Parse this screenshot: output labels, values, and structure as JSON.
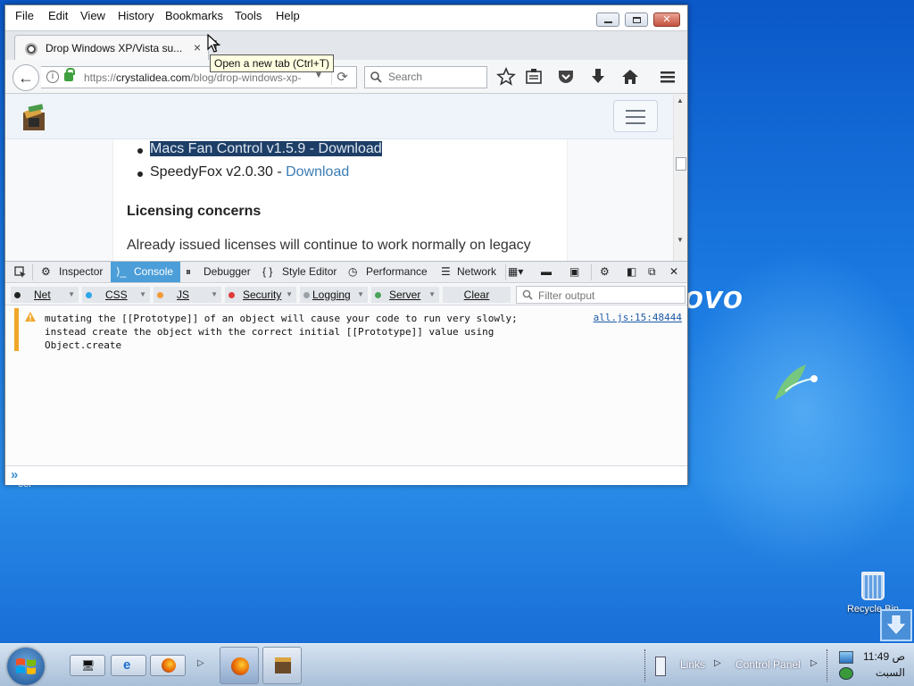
{
  "desktop": {
    "wallpaper_text": "ovo",
    "recycle_bin_label": "Recycle Bin",
    "shortcut_label_partial": "ool"
  },
  "window": {
    "menu": [
      "File",
      "Edit",
      "View",
      "History",
      "Bookmarks",
      "Tools",
      "Help"
    ],
    "tab_title": "Drop Windows XP/Vista su...",
    "tab_close": "×",
    "new_tab_glyph": "+",
    "tooltip": "Open a new tab (Ctrl+T)",
    "url_prefix": "https://",
    "url_host": "crystalidea.com",
    "url_path": "/blog/drop-windows-xp-",
    "search_placeholder": "Search"
  },
  "page": {
    "items": [
      {
        "text": "Macs Fan Control v1.5.9 - Download",
        "selected": true
      },
      {
        "text": "SpeedyFox v2.0.30 - ",
        "link": "Download"
      }
    ],
    "heading": "Licensing concerns",
    "paragraph": "Already issued licenses will continue to work normally on legacy"
  },
  "devtools": {
    "tabs": [
      "Inspector",
      "Console",
      "Debugger",
      "Style Editor",
      "Performance",
      "Network"
    ],
    "active_tab": "Console",
    "filters": [
      {
        "label": "Net",
        "dot": "#222222"
      },
      {
        "label": "CSS",
        "dot": "#2ba6e8"
      },
      {
        "label": "JS",
        "dot": "#f29a38"
      },
      {
        "label": "Security",
        "dot": "#e03a3a"
      },
      {
        "label": "Logging",
        "dot": "#9aa1a8"
      },
      {
        "label": "Server",
        "dot": "#4aa35a"
      }
    ],
    "clear_label": "Clear",
    "filter_placeholder": "Filter output",
    "message": "mutating the [[Prototype]] of an object will cause your code to run very slowly;\ninstead create the object with the correct initial [[Prototype]] value using\nObject.create",
    "message_source": "all.js:15:48444",
    "prompt": "»"
  },
  "taskbar": {
    "links_label": "Links",
    "control_panel_label": "Control Panel",
    "clock_time": "11:49 ص",
    "clock_day": "السبت"
  },
  "colors": {
    "accent": "#4c9ed9",
    "warning": "#f0a72b",
    "link": "#3b7db5"
  }
}
